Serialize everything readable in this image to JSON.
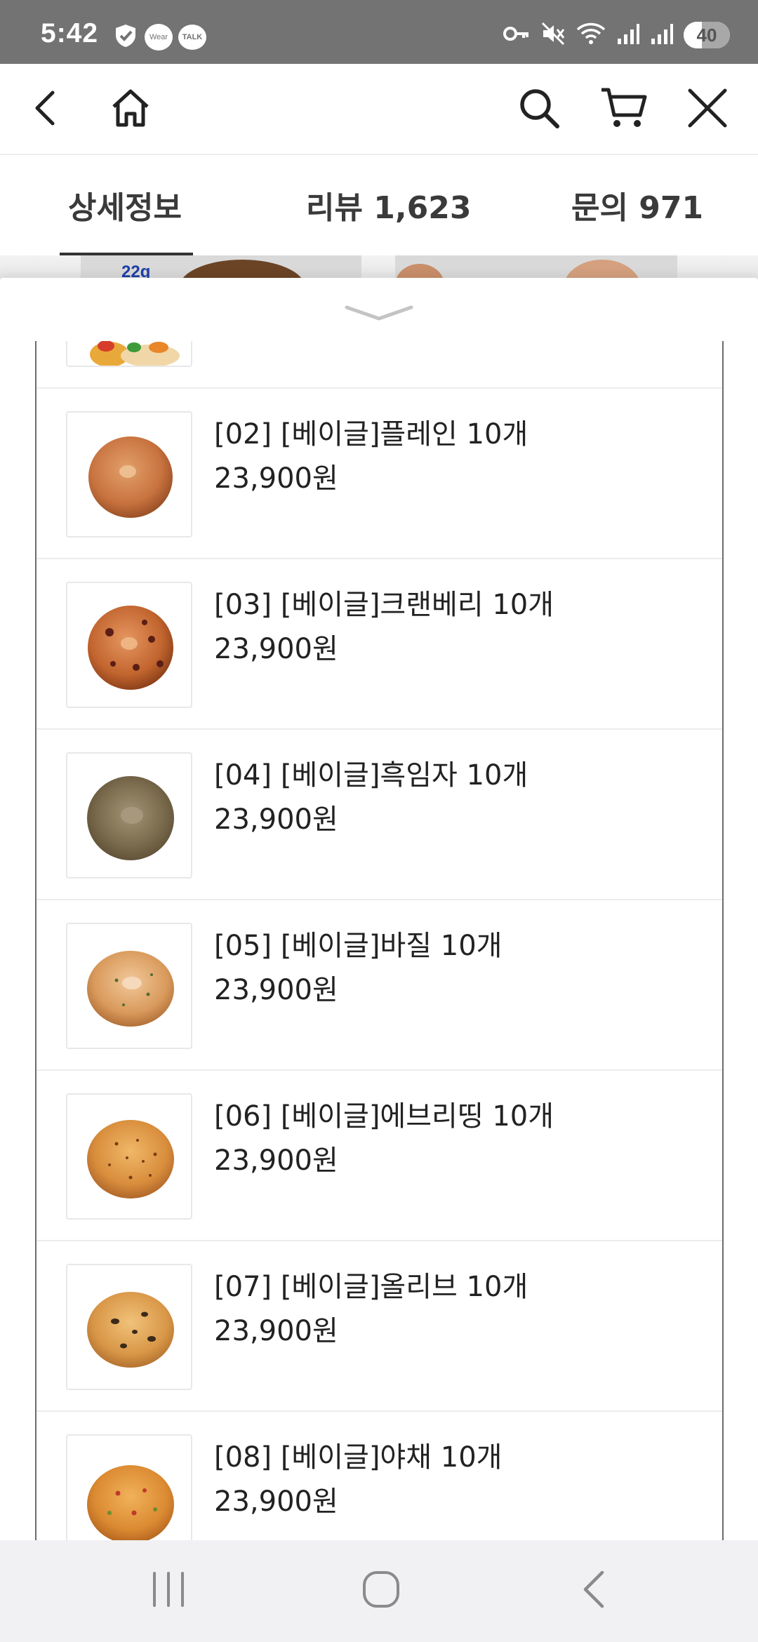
{
  "status_bar": {
    "time": "5:42",
    "left_icons": [
      "shield-check-icon",
      "wear-icon",
      "talk-icon"
    ],
    "wear_text": "Wear",
    "talk_text": "TALK",
    "right_icons": [
      "key-icon",
      "mute-icon",
      "wifi-icon",
      "signal-icon",
      "signal-icon"
    ],
    "battery": "40",
    "battery_level": 0.4
  },
  "top_nav": {
    "icons": [
      "back-icon",
      "home-icon",
      "search-icon",
      "cart-icon",
      "close-icon"
    ]
  },
  "tabs": [
    {
      "label": "상세정보",
      "active": true
    },
    {
      "label": "리뷰 1,623",
      "active": false
    },
    {
      "label": "문의 971",
      "active": false
    }
  ],
  "peek": {
    "badge": "22g"
  },
  "sheet": {
    "handle_icon": "chevron-down-icon",
    "items": [
      {
        "name": "",
        "price": "",
        "image": "mixed-food-thumbnail"
      },
      {
        "name": "[02] [베이글]플레인 10개",
        "price": "23,900원",
        "image": "plain-bagel"
      },
      {
        "name": "[03] [베이글]크랜베리 10개",
        "price": "23,900원",
        "image": "cranberry-bagel"
      },
      {
        "name": "[04] [베이글]흑임자 10개",
        "price": "23,900원",
        "image": "black-sesame-bagel"
      },
      {
        "name": "[05] [베이글]바질 10개",
        "price": "23,900원",
        "image": "basil-bagel"
      },
      {
        "name": "[06] [베이글]에브리띵 10개",
        "price": "23,900원",
        "image": "everything-bagel"
      },
      {
        "name": "[07] [베이글]올리브 10개",
        "price": "23,900원",
        "image": "olive-bagel"
      },
      {
        "name": "[08] [베이글]야채 10개",
        "price": "23,900원",
        "image": "vegetable-bagel"
      }
    ]
  },
  "system_nav": {
    "icons": [
      "recent-apps-icon",
      "home-button-icon",
      "back-button-icon"
    ]
  },
  "colors": {
    "status_bar_bg": "#737373",
    "tab_active": "#333333",
    "text": "#222222",
    "system_nav_bg": "#f1f1f3"
  }
}
